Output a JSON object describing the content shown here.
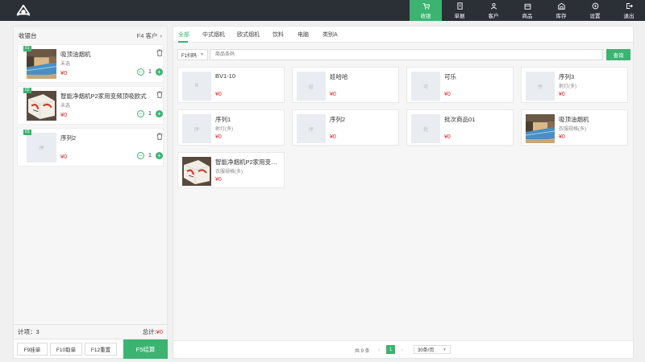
{
  "nav": {
    "items": [
      {
        "label": "收银",
        "icon": "cart-icon",
        "active": true
      },
      {
        "label": "单据",
        "icon": "document-icon",
        "active": false
      },
      {
        "label": "客户",
        "icon": "user-icon",
        "active": false
      },
      {
        "label": "商品",
        "icon": "box-icon",
        "active": false
      },
      {
        "label": "库存",
        "icon": "warehouse-icon",
        "active": false
      },
      {
        "label": "设置",
        "icon": "gear-icon",
        "active": false
      },
      {
        "label": "退出",
        "icon": "logout-icon",
        "active": false
      }
    ]
  },
  "left": {
    "title": "收银台",
    "customer": "F4 客户",
    "cart": [
      {
        "badge": "01",
        "name": "吸顶油烟机",
        "spec": "未选",
        "price": "¥0",
        "qty": "1",
        "thumb": "pool",
        "placeholder": ""
      },
      {
        "badge": "02",
        "name": "智能净烟机P2家用变频顶吸欧式",
        "spec": "未选",
        "price": "¥0",
        "qty": "1",
        "thumb": "box",
        "placeholder": ""
      },
      {
        "badge": "03",
        "name": "序列2",
        "spec": "",
        "price": "¥0",
        "qty": "1",
        "thumb": "",
        "placeholder": "序"
      }
    ],
    "count_label": "计项：3",
    "total_label": "总计:",
    "total_value": "¥0",
    "buttons": {
      "hold": "F9挂单",
      "take": "F10取单",
      "reset": "F12重置",
      "pay": "F5结算"
    }
  },
  "right": {
    "tabs": [
      "全部",
      "中式烟机",
      "欧式烟机",
      "饮料",
      "电脑",
      "类别A"
    ],
    "active_tab": 0,
    "scan_label": "F1扫码",
    "search_placeholder": "商品条码",
    "search_button": "查询",
    "products": [
      {
        "name": "BV1-10",
        "spec": "",
        "price": "¥0",
        "thumb": "",
        "placeholder": "B"
      },
      {
        "name": "娃哈哈",
        "spec": "",
        "price": "¥0",
        "thumb": "",
        "placeholder": "娃"
      },
      {
        "name": "可乐",
        "spec": "",
        "price": "¥0",
        "thumb": "",
        "placeholder": "可"
      },
      {
        "name": "序列3",
        "spec": "射灯(多)",
        "price": "¥0",
        "thumb": "",
        "placeholder": "序"
      },
      {
        "name": "序列1",
        "spec": "射灯(多)",
        "price": "¥0",
        "thumb": "",
        "placeholder": "序"
      },
      {
        "name": "序列2",
        "spec": "",
        "price": "¥0",
        "thumb": "",
        "placeholder": "序"
      },
      {
        "name": "批次商品01",
        "spec": "",
        "price": "¥0",
        "thumb": "",
        "placeholder": "批"
      },
      {
        "name": "吸顶油烟机",
        "spec": "衣服规格(多)",
        "price": "¥0",
        "thumb": "pool",
        "placeholder": ""
      },
      {
        "name": "智能净烟机P2家用变频顶吸欧式",
        "spec": "衣服规格(多)",
        "price": "¥0",
        "thumb": "box",
        "placeholder": ""
      }
    ],
    "pager": {
      "total": "共 9 条",
      "page": "1",
      "size": "30条/页"
    }
  }
}
